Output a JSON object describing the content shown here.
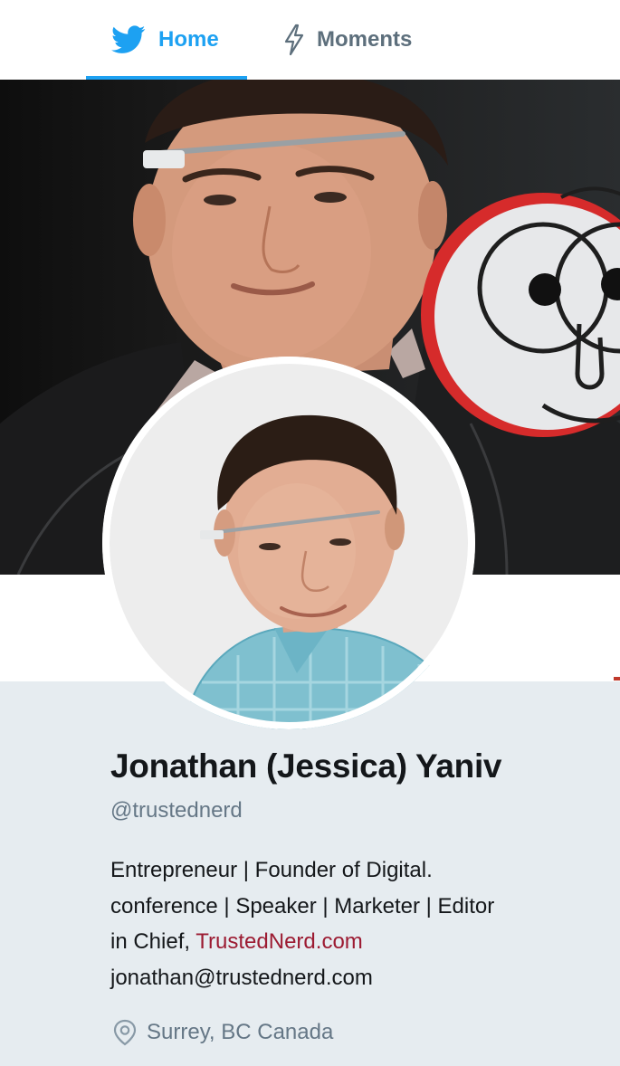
{
  "nav": {
    "tabs": [
      {
        "label": "Home",
        "icon": "bird-icon",
        "active": true
      },
      {
        "label": "Moments",
        "icon": "lightning-icon",
        "active": false
      }
    ]
  },
  "profile": {
    "name": "Jonathan (Jessica) Yaniv",
    "handle": "@trustednerd",
    "bio": {
      "line1": "Entrepreneur | Founder of Digital.",
      "line2": "conference | Speaker | Marketer | Editor",
      "line3_prefix": "in Chief, ",
      "link": "TrustedNerd.com",
      "email": "jonathan@trustednerd.com"
    },
    "location": "Surrey, BC Canada"
  },
  "colors": {
    "accent": "#1da1f2",
    "text": "#14171a",
    "muted": "#657786",
    "link": "#9c1b32",
    "card_background": "#e6ecf0"
  }
}
